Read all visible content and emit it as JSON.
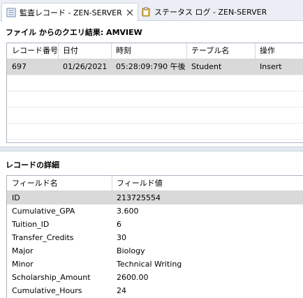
{
  "tabs": [
    {
      "label": "監査レコード - ZEN-SERVER",
      "icon": "audit-record-icon",
      "active": true
    },
    {
      "label": "ステータス ログ - ZEN-SERVER",
      "icon": "clipboard-icon",
      "active": false
    }
  ],
  "query_result": {
    "title": "ファイル からのクエリ結果:  AMVIEW",
    "columns": [
      "レコード番号",
      "日付",
      "時刻",
      "テーブル名",
      "操作"
    ],
    "rows": [
      [
        "697",
        "01/26/2021",
        "05:28:09:790 午後",
        "Student",
        "Insert"
      ]
    ]
  },
  "record_detail": {
    "title": "レコードの詳細",
    "columns": [
      "フィールド名",
      "フィールド値"
    ],
    "rows": [
      [
        "ID",
        "213725554"
      ],
      [
        "Cumulative_GPA",
        "3.600"
      ],
      [
        "Tuition_ID",
        "6"
      ],
      [
        "Transfer_Credits",
        "30"
      ],
      [
        "Major",
        "Biology"
      ],
      [
        "Minor",
        "Technical Writing"
      ],
      [
        "Scholarship_Amount",
        "2600.00"
      ],
      [
        "Cumulative_Hours",
        "24"
      ]
    ]
  },
  "colors": {
    "tabbar_bg": "#ebeff5",
    "selected_row": "#d9d9d9",
    "border": "#a9b3bf"
  }
}
